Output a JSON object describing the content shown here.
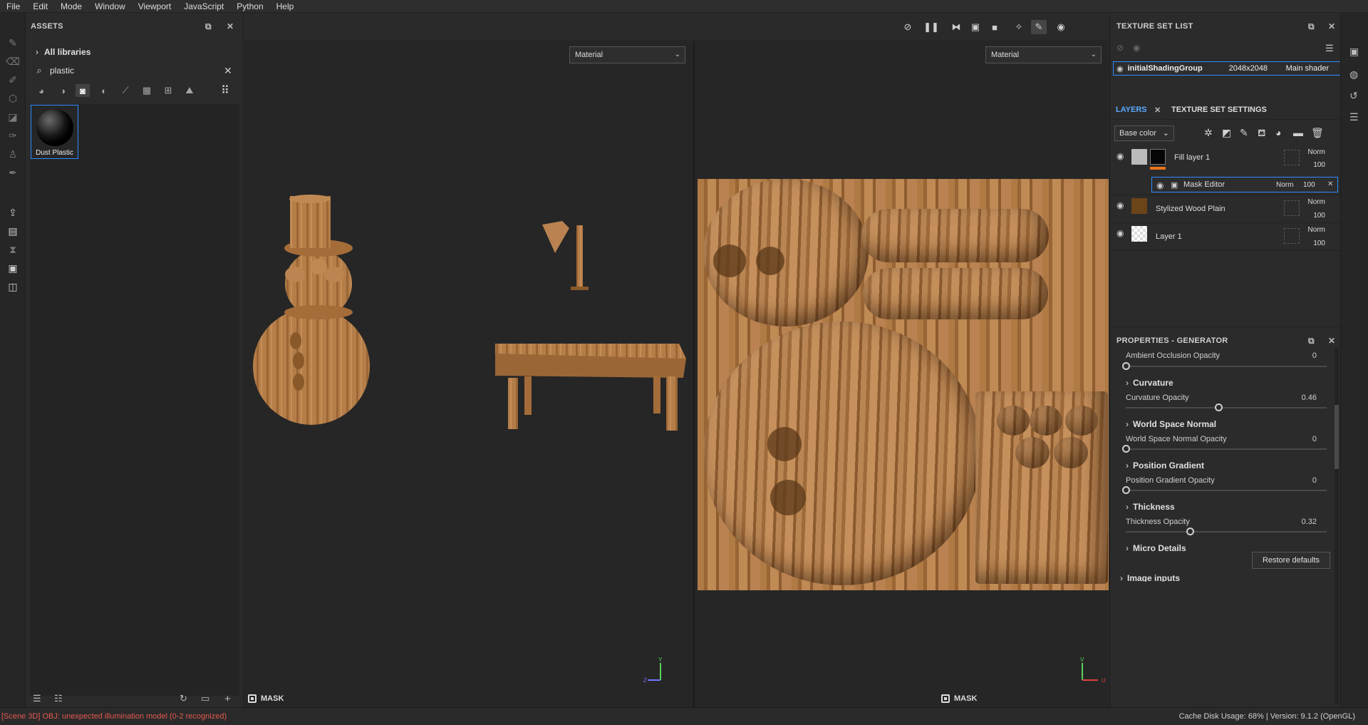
{
  "menu": [
    "File",
    "Edit",
    "Mode",
    "Window",
    "Viewport",
    "JavaScript",
    "Python",
    "Help"
  ],
  "assets": {
    "title": "ASSETS",
    "all_libraries": "All libraries",
    "search_value": "plastic",
    "items": [
      {
        "label": "Dust Plastic"
      }
    ]
  },
  "viewport": {
    "left_material": "Material",
    "right_material": "Material",
    "left_mask": "MASK",
    "right_mask": "MASK",
    "axis_left": {
      "y": "Y",
      "z": "Z"
    },
    "axis_right": {
      "v": "V",
      "u": "U"
    }
  },
  "texture_set_list": {
    "title": "TEXTURE SET LIST",
    "row": {
      "name": "initialShadingGroup",
      "size": "2048x2048",
      "shader": "Main shader"
    }
  },
  "layers": {
    "tab_layers": "LAYERS",
    "tab_settings": "TEXTURE SET SETTINGS",
    "channel": "Base color",
    "items": [
      {
        "name": "Fill layer 1",
        "blend": "Norm",
        "opacity": "100"
      },
      {
        "name": "Mask Editor",
        "blend": "Norm",
        "opacity": "100"
      },
      {
        "name": "Stylized Wood Plain",
        "blend": "Norm",
        "opacity": "100"
      },
      {
        "name": "Layer 1",
        "blend": "Norm",
        "opacity": "100"
      }
    ]
  },
  "properties": {
    "title": "PROPERTIES - GENERATOR",
    "ao_label": "Ambient Occlusion Opacity",
    "ao_value": "0",
    "ao_level": 0,
    "curv_section": "Curvature",
    "curv_label": "Curvature Opacity",
    "curv_value": "0.46",
    "curv_level": 0.46,
    "wsn_section": "World Space Normal",
    "wsn_label": "World Space Normal Opacity",
    "wsn_value": "0",
    "wsn_level": 0,
    "pg_section": "Position Gradient",
    "pg_label": "Position Gradient Opacity",
    "pg_value": "0",
    "pg_level": 0,
    "th_section": "Thickness",
    "th_label": "Thickness Opacity",
    "th_value": "0.32",
    "th_level": 0.32,
    "md_section": "Micro Details",
    "restore": "Restore defaults",
    "next_section": "Image inputs"
  },
  "status": {
    "error": "[Scene 3D] OBJ: unexpected illumination model (0-2 recognized)",
    "info": "Cache Disk Usage:    68% | Version: 9.1.2 (OpenGL)"
  },
  "colors": {
    "accent": "#2f8cff",
    "error": "#e3584e",
    "wood": "#b07a45"
  }
}
